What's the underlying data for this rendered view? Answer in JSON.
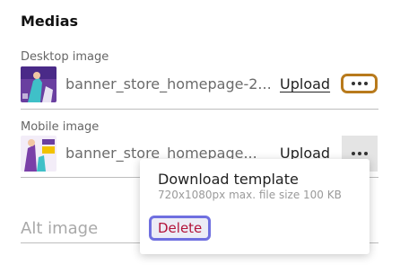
{
  "section": {
    "title": "Medias"
  },
  "desktop": {
    "label": "Desktop image",
    "filename": "banner_store_homepage-2...",
    "upload_label": "Upload"
  },
  "mobile": {
    "label": "Mobile image",
    "filename": "banner_store_homepage...",
    "upload_label": "Upload"
  },
  "menu": {
    "download_label": "Download template",
    "download_hint": "720x1080px max. file size 100 KB",
    "delete_label": "Delete"
  },
  "alt": {
    "placeholder": "Alt image"
  },
  "colors": {
    "focus_ring": "#b87a1c",
    "delete_text": "#b3143a",
    "delete_focus": "#6f6fe0"
  }
}
